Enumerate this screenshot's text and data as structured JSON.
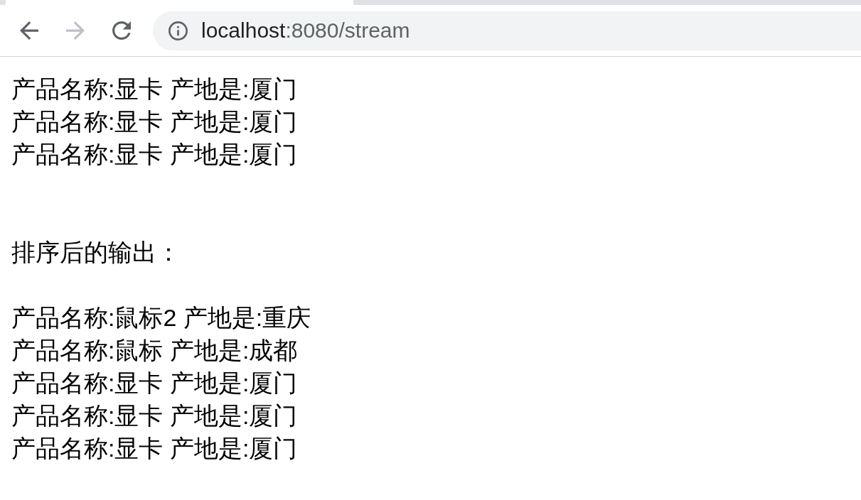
{
  "browser": {
    "nav_buttons": [
      {
        "kind": "back",
        "disabled": false
      },
      {
        "kind": "forward",
        "disabled": true
      },
      {
        "kind": "reload",
        "disabled": false
      }
    ],
    "address_bar": {
      "host": "localhost",
      "path": ":8080/stream"
    }
  },
  "page": {
    "output_lines": [
      "产品名称:显卡 产地是:厦门",
      "产品名称:显卡 产地是:厦门",
      "产品名称:显卡 产地是:厦门"
    ],
    "sorted_heading": "排序后的输出：",
    "sorted_lines": [
      "产品名称:鼠标2 产地是:重庆",
      "产品名称:鼠标 产地是:成都",
      "产品名称:显卡 产地是:厦门",
      "产品名称:显卡 产地是:厦门",
      "产品名称:显卡 产地是:厦门"
    ]
  }
}
